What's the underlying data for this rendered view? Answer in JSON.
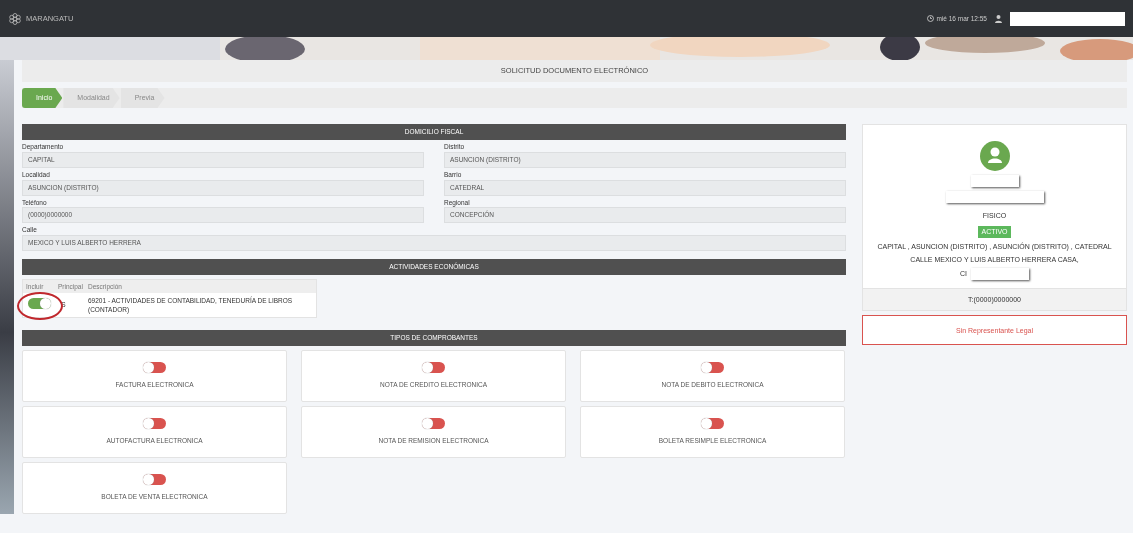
{
  "topbar": {
    "logo": "MARANGATU",
    "datetime": "mié 16 mar 12:55"
  },
  "page_title": "SOLICITUD DOCUMENTO ELECTRÓNICO",
  "steps": [
    {
      "label": "Inicio",
      "selected": true
    },
    {
      "label": "Modalidad",
      "selected": false
    },
    {
      "label": "Previa",
      "selected": false
    }
  ],
  "domicilio": {
    "title": "DOMICILIO FISCAL",
    "fields": [
      {
        "label": "Departamento",
        "value": "CAPITAL"
      },
      {
        "label": "Distrito",
        "value": "ASUNCION (DISTRITO)"
      },
      {
        "label": "Localidad",
        "value": "ASUNCION (DISTRITO)"
      },
      {
        "label": "Barrio",
        "value": "CATEDRAL"
      },
      {
        "label": "Teléfono",
        "value": "(0000)0000000"
      },
      {
        "label": "Regional",
        "value": "CONCEPCIÓN"
      },
      {
        "label": "Calle",
        "value": "MEXICO Y LUIS ALBERTO HERRERA",
        "wide": true
      }
    ]
  },
  "actividades": {
    "title": "ACTIVIDADES ECONÓMICAS",
    "columns": [
      "Incluir",
      "Principal",
      "Descripción"
    ],
    "rows": [
      {
        "on": true,
        "principal": "S",
        "description": "69201 - ACTIVIDADES DE CONTABILIDAD, TENEDURÍA DE LIBROS (CONTADOR)",
        "highlighted": true
      }
    ]
  },
  "comprobantes": {
    "title": "TIPOS DE COMPROBANTES",
    "items": [
      {
        "label": "FACTURA ELECTRONICA",
        "on": false
      },
      {
        "label": "NOTA DE CREDITO ELECTRONICA",
        "on": false
      },
      {
        "label": "NOTA DE DEBITO ELECTRONICA",
        "on": false
      },
      {
        "label": "AUTOFACTURA ELECTRONICA",
        "on": false
      },
      {
        "label": "NOTA DE REMISION ELECTRONICA",
        "on": false
      },
      {
        "label": "BOLETA RESIMPLE ELECTRONICA",
        "on": false
      },
      {
        "label": "BOLETA DE VENTA ELECTRONICA",
        "on": false
      }
    ]
  },
  "profile": {
    "type": "FISICO",
    "status": "ACTIVO",
    "address_lines": [
      "CAPITAL , ASUNCION (DISTRITO) , ASUNCIÓN (DISTRITO) , CATEDRAL",
      "CALLE MEXICO Y LUIS ALBERTO HERRERA CASA,"
    ],
    "ci_prefix": "CI",
    "phone": "T:(0000)0000000",
    "legal": "Sin Representante Legal"
  }
}
